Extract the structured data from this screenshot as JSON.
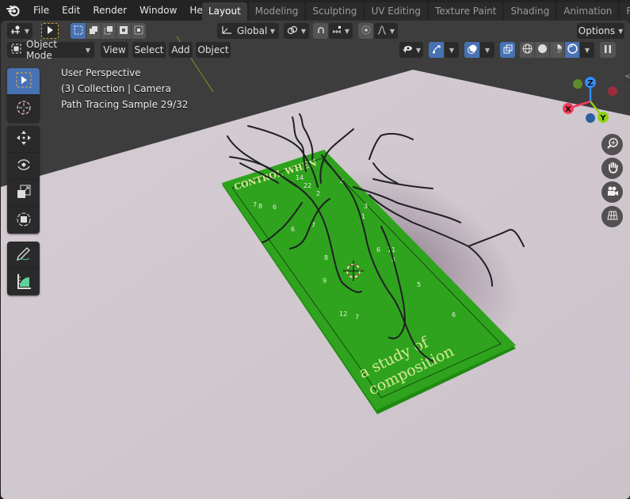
{
  "app": {
    "logo_icon": "blender-logo-icon"
  },
  "menu": [
    {
      "label": "File"
    },
    {
      "label": "Edit"
    },
    {
      "label": "Render"
    },
    {
      "label": "Window"
    },
    {
      "label": "Help"
    }
  ],
  "workspaces": [
    {
      "label": "Layout",
      "active": true
    },
    {
      "label": "Modeling"
    },
    {
      "label": "Sculpting"
    },
    {
      "label": "UV Editing"
    },
    {
      "label": "Texture Paint"
    },
    {
      "label": "Shading"
    },
    {
      "label": "Animation"
    },
    {
      "label": "Rendering"
    }
  ],
  "tool_header": {
    "transform_orientation": "Global",
    "options_label": "Options"
  },
  "viewport_header": {
    "mode": "Object Mode",
    "menus": [
      "View",
      "Select",
      "Add",
      "Object"
    ]
  },
  "overlay": {
    "view_name": "User Perspective",
    "collection": "(3) Collection | Camera",
    "render_status": "Path Tracing Sample 29/32"
  },
  "gizmo": {
    "axes": [
      "X",
      "Y",
      "Z"
    ],
    "colors": {
      "x": "#f53a58",
      "y": "#8bd40c",
      "z": "#2f8dff"
    }
  },
  "scene": {
    "board_title": "CONTROL WHEN",
    "board_subtitle_line1": "a study of",
    "board_subtitle_line2": "composition",
    "board_color": "#2fa31d",
    "floor_color": "#d2c9d0",
    "numbers": [
      "7",
      "8",
      "6",
      "14",
      "22",
      "2",
      "4",
      "3",
      "1",
      "6",
      "7",
      "8",
      "6",
      "11",
      "4",
      "9",
      "5",
      "12",
      "7",
      "6"
    ]
  }
}
